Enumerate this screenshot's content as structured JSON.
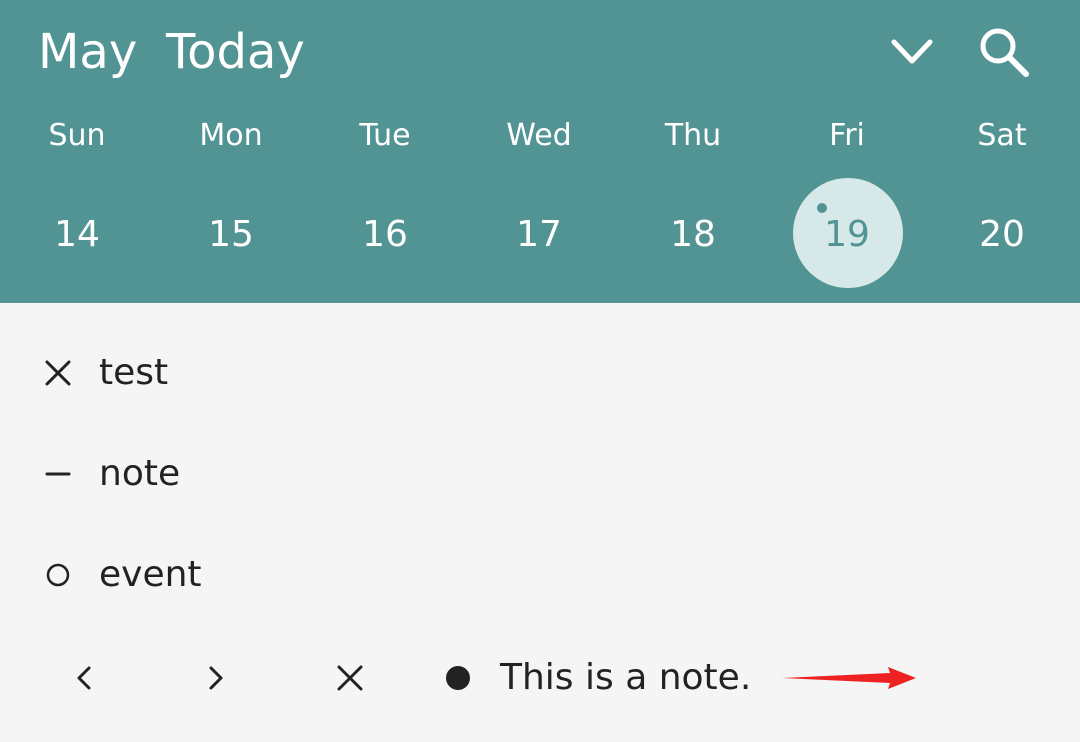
{
  "header": {
    "month": "May",
    "today_label": "Today",
    "weekdays": [
      "Sun",
      "Mon",
      "Tue",
      "Wed",
      "Thu",
      "Fri",
      "Sat"
    ],
    "dates": [
      "14",
      "15",
      "16",
      "17",
      "18",
      "19",
      "20"
    ],
    "selected_index": 5
  },
  "entries": [
    {
      "symbol": "cross-icon",
      "text": "test"
    },
    {
      "symbol": "dash-icon",
      "text": "note"
    },
    {
      "symbol": "circle-icon",
      "text": "event"
    }
  ],
  "toolbar": {
    "note_text": "This is a note."
  },
  "colors": {
    "header_bg": "#529494",
    "selected_bg": "#d6e8e7",
    "body_bg": "#f5f5f5",
    "arrow": "#ee2222"
  }
}
